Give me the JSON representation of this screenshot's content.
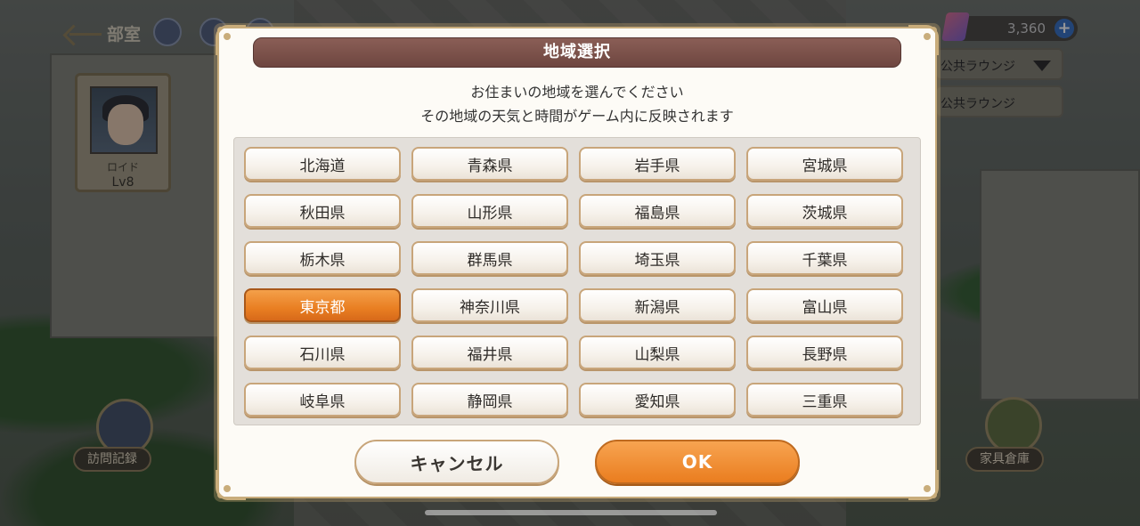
{
  "hud": {
    "back_label": "部室",
    "currency_3": "3,360",
    "plus_symbol": "+",
    "lounge_1": "公共ラウンジ",
    "lounge_2": "公共ラウンジ"
  },
  "character": {
    "name": "ロイド",
    "level": "Lv8"
  },
  "bottom": {
    "left_label": "訪問記録",
    "right_label": "家具倉庫"
  },
  "dialog": {
    "title": "地域選択",
    "description_line1": "お住まいの地域を選んでください",
    "description_line2": "その地域の天気と時間がゲーム内に反映されます",
    "prefectures": [
      "北海道",
      "青森県",
      "岩手県",
      "宮城県",
      "秋田県",
      "山形県",
      "福島県",
      "茨城県",
      "栃木県",
      "群馬県",
      "埼玉県",
      "千葉県",
      "東京都",
      "神奈川県",
      "新潟県",
      "富山県",
      "石川県",
      "福井県",
      "山梨県",
      "長野県",
      "岐阜県",
      "静岡県",
      "愛知県",
      "三重県"
    ],
    "selected": "東京都",
    "cancel_label": "キャンセル",
    "ok_label": "OK"
  },
  "colors": {
    "accent": "#e97f22",
    "title_bar": "#7a504a",
    "border_gold": "#c8a57a"
  }
}
